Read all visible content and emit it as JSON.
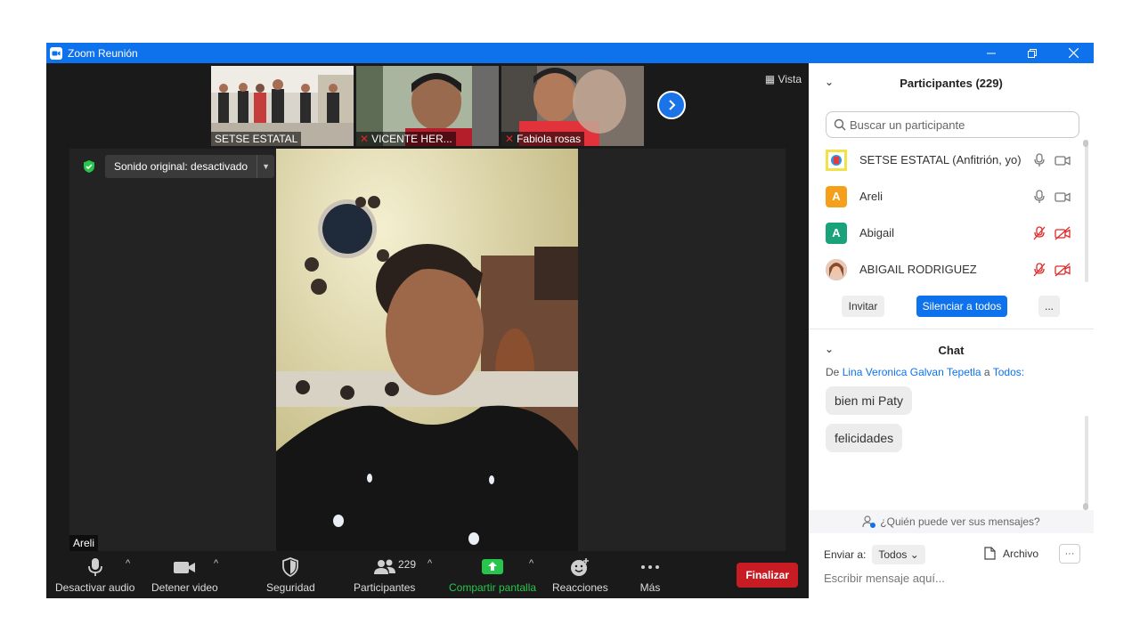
{
  "window": {
    "title": "Zoom Reunión",
    "controls": [
      "minimize",
      "restore",
      "close"
    ]
  },
  "thumbnails": [
    {
      "name": "SETSE ESTATAL",
      "muted": false
    },
    {
      "name": "VICENTE HER...",
      "muted": true
    },
    {
      "name": "Fabiola rosas",
      "muted": true
    }
  ],
  "view_label": "Vista",
  "stage": {
    "sound_label": "Sonido original: desactivado",
    "speaker_name": "Areli"
  },
  "toolbar": {
    "audio_label": "Desactivar audio",
    "video_label": "Detener video",
    "security_label": "Seguridad",
    "participants_label": "Participantes",
    "participants_count": "229",
    "share_label": "Compartir pantalla",
    "reactions_label": "Reacciones",
    "more_label": "Más",
    "end_label": "Finalizar"
  },
  "participants_panel": {
    "title": "Participantes (229)",
    "search_placeholder": "Buscar un participante",
    "items": [
      {
        "name": "SETSE ESTATAL (Anfitrión, yo)",
        "initial": "",
        "color": "#f2e24a",
        "muted": false
      },
      {
        "name": "Areli",
        "initial": "A",
        "color": "#f59f1a",
        "muted": false
      },
      {
        "name": "Abigail",
        "initial": "A",
        "color": "#1aa37a",
        "muted": true
      },
      {
        "name": "ABIGAIL RODRIGUEZ",
        "initial": "",
        "color": "#d7a48c",
        "muted": true
      }
    ],
    "invite_label": "Invitar",
    "mute_all_label": "Silenciar a todos",
    "more_label": "..."
  },
  "chat": {
    "title": "Chat",
    "from_prefix": "De",
    "from_name": "Lina Veronica Galvan Tepetla",
    "to_word": "a",
    "to_name": "Todos:",
    "messages": [
      "bien mi Paty",
      "felicidades"
    ],
    "who_can_see": "¿Quién puede ver sus mensajes?",
    "send_to_label": "Enviar a:",
    "send_to_value": "Todos",
    "file_label": "Archivo",
    "more_label": "···",
    "input_placeholder": "Escribir mensaje aquí..."
  },
  "colors": {
    "titlebar": "#0e72ed",
    "end_button": "#c71c23",
    "share_green": "#27c54b",
    "mute_all": "#0e72ed",
    "muted_red": "#e02828"
  }
}
